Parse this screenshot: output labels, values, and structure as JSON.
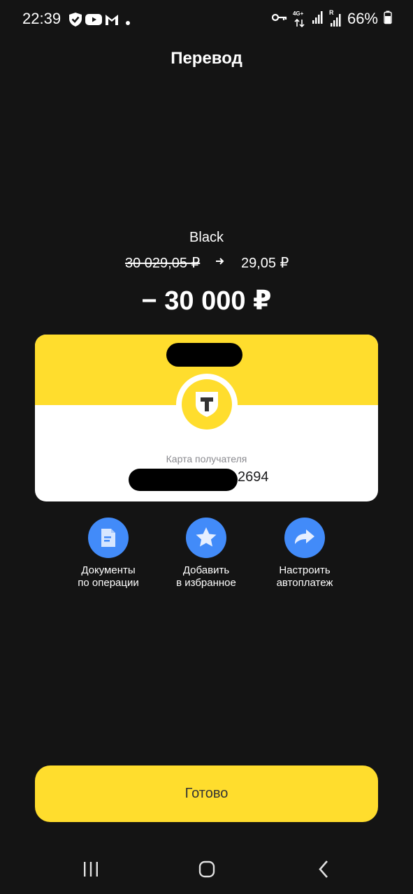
{
  "status_bar": {
    "time": "22:39",
    "battery_percent": "66%",
    "network_label": "4G+",
    "roaming_label": "R",
    "left_icons": [
      "shield-check-icon",
      "youtube-icon",
      "gmail-icon",
      "dot-icon"
    ],
    "right_icons": [
      "key-icon",
      "data-arrows-icon",
      "signal-icon",
      "signal-roaming-icon",
      "battery-icon"
    ]
  },
  "header": {
    "title": "Перевод"
  },
  "account": {
    "name": "Black",
    "balance_before": "30 029,05 ₽",
    "balance_after": "29,05 ₽",
    "amount": "− 30 000 ₽"
  },
  "recipient_card": {
    "label": "Карта получателя",
    "card_number_suffix": "2694",
    "logo": "tinkoff-shield-icon"
  },
  "actions": [
    {
      "label_line1": "Документы",
      "label_line2": "по операции",
      "icon": "document-icon"
    },
    {
      "label_line1": "Добавить",
      "label_line2": "в избранное",
      "icon": "star-icon"
    },
    {
      "label_line1": "Настроить",
      "label_line2": "автоплатеж",
      "icon": "share-arrow-icon"
    }
  ],
  "done_button": {
    "label": "Готово"
  },
  "colors": {
    "background": "#141414",
    "accent_yellow": "#FFDD2D",
    "action_blue": "#428BF9",
    "text_primary": "#ffffff",
    "text_muted": "#8a8a8f"
  },
  "nav_bar": {
    "icons": [
      "recent-apps-icon",
      "home-icon",
      "back-icon"
    ]
  }
}
